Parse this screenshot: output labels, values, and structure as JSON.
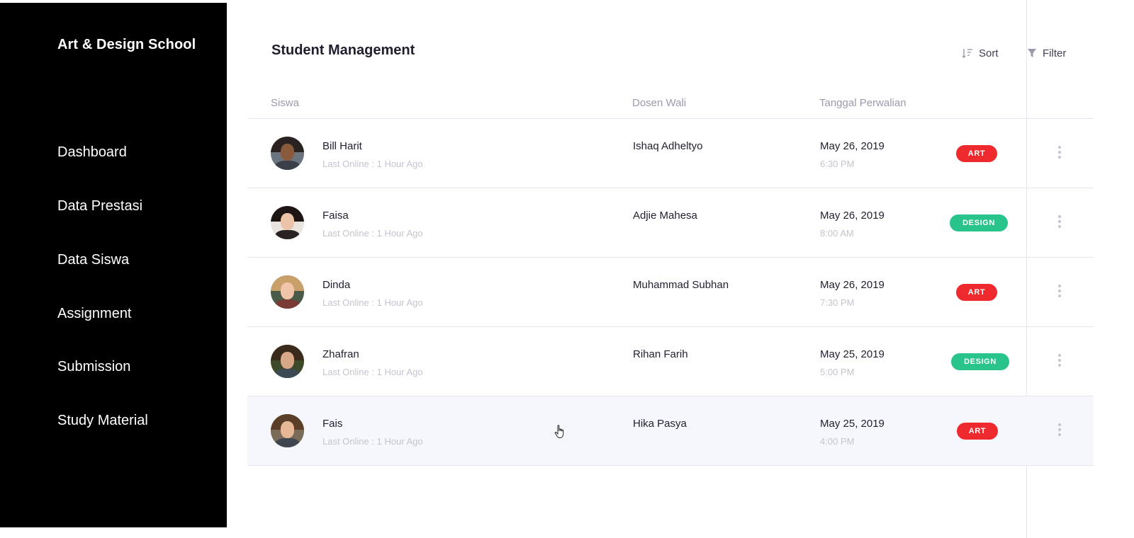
{
  "sidebar": {
    "brand": "Art & Design School",
    "items": [
      {
        "label": "Dashboard"
      },
      {
        "label": "Data Prestasi"
      },
      {
        "label": "Data Siswa"
      },
      {
        "label": "Assignment"
      },
      {
        "label": "Submission"
      },
      {
        "label": "Study Material"
      }
    ]
  },
  "main": {
    "title": "Student Management",
    "toolbar": {
      "sort_label": "Sort",
      "filter_label": "Filter",
      "sort_icon": "sort-icon",
      "filter_icon": "filter-icon"
    },
    "columns": {
      "student": "Siswa",
      "advisor": "Dosen Wali",
      "date": "Tanggal Perwalian"
    },
    "rows": [
      {
        "name": "Bill Harit",
        "last_online": "Last Online : 1 Hour Ago",
        "advisor": "Ishaq Adheltyo",
        "date": "May 26, 2019",
        "time": "6:30 PM",
        "badge": "ART"
      },
      {
        "name": "Faisa",
        "last_online": "Last Online : 1 Hour Ago",
        "advisor": "Adjie Mahesa",
        "date": "May 26, 2019",
        "time": "8:00 AM",
        "badge": "DESIGN"
      },
      {
        "name": "Dinda",
        "last_online": "Last Online : 1 Hour Ago",
        "advisor": "Muhammad Subhan",
        "date": "May 26, 2019",
        "time": "7:30 PM",
        "badge": "ART"
      },
      {
        "name": "Zhafran",
        "last_online": "Last Online : 1 Hour Ago",
        "advisor": "Rihan Farih",
        "date": "May 25, 2019",
        "time": "5:00 PM",
        "badge": "DESIGN"
      },
      {
        "name": "Fais",
        "last_online": "Last Online : 1 Hour Ago",
        "advisor": "Hika Pasya",
        "date": "May 25, 2019",
        "time": "4:00 PM",
        "badge": "ART"
      }
    ]
  },
  "colors": {
    "sidebar_bg": "#000000",
    "art_badge": "#ee2a2f",
    "design_badge": "#29c48b",
    "row_highlight": "#f6f7fc",
    "muted_text": "#c4c4cf",
    "header_text": "#9a9aae"
  }
}
